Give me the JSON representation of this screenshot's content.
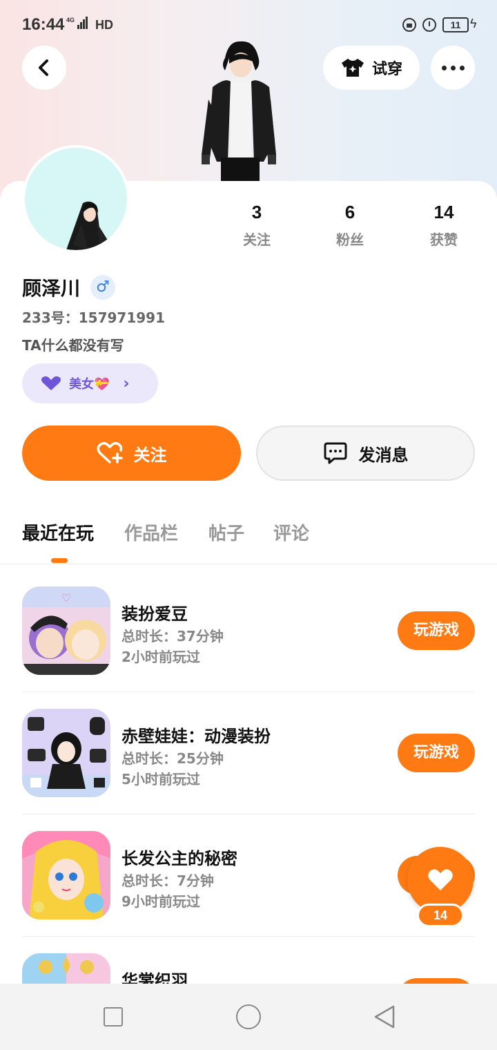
{
  "status": {
    "time": "16:44",
    "network": "4G",
    "hd": "HD",
    "battery": "11"
  },
  "header": {
    "try_on_label": "试穿"
  },
  "profile": {
    "name": "顾泽川",
    "gender_symbol": "♂",
    "id_text": "233号：157971991",
    "bio": "TA什么都没有写",
    "tag_label": "美女💝",
    "stats": [
      {
        "value": "3",
        "label": "关注"
      },
      {
        "value": "6",
        "label": "粉丝"
      },
      {
        "value": "14",
        "label": "获赞"
      }
    ]
  },
  "actions": {
    "follow_label": "关注",
    "message_label": "发消息"
  },
  "tabs": [
    {
      "label": "最近在玩",
      "active": true
    },
    {
      "label": "作品栏",
      "active": false
    },
    {
      "label": "帖子",
      "active": false
    },
    {
      "label": "评论",
      "active": false
    }
  ],
  "games": [
    {
      "title": "装扮爱豆",
      "duration": "总时长：37分钟",
      "last_played": "2小时前玩过",
      "play_label": "玩游戏"
    },
    {
      "title": "赤壁娃娃：动漫装扮",
      "duration": "总时长：25分钟",
      "last_played": "5小时前玩过",
      "play_label": "玩游戏"
    },
    {
      "title": "长发公主的秘密",
      "duration": "总时长：7分钟",
      "last_played": "9小时前玩过",
      "play_label": "玩游戏"
    },
    {
      "title": "华裳织羽",
      "duration": "",
      "last_played": "",
      "play_label": ""
    }
  ],
  "like_float": {
    "count": "14"
  },
  "colors": {
    "accent": "#ff7a12",
    "tag_bg": "#ebe8fb",
    "tag_text": "#6f55d8"
  }
}
